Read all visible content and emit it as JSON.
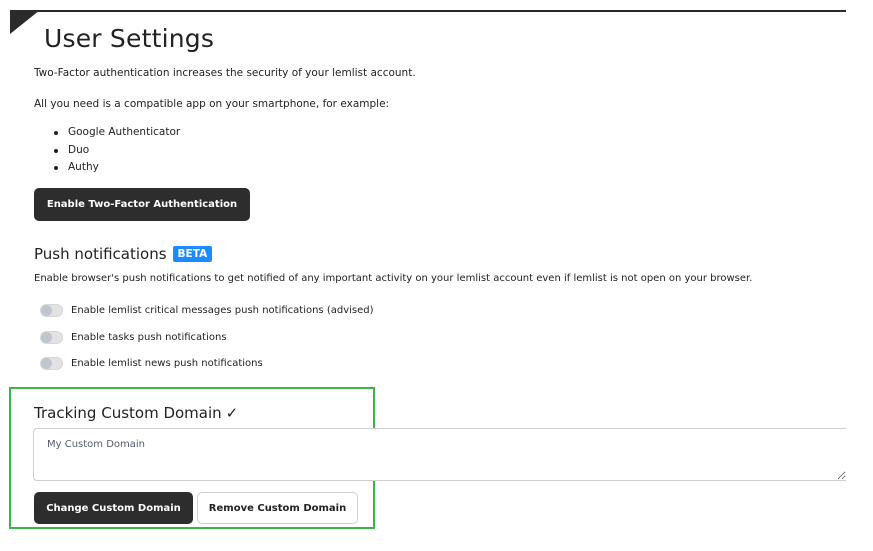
{
  "page": {
    "title": "User Settings"
  },
  "two_factor": {
    "intro": "Two-Factor authentication increases the security of your lemlist account.",
    "apps_lead": "All you need is a compatible app on your smartphone, for example:",
    "apps": [
      "Google Authenticator",
      "Duo",
      "Authy"
    ],
    "enable_button": "Enable Two-Factor Authentication"
  },
  "push_notifications": {
    "heading": "Push notifications",
    "badge": "BETA",
    "badge_color": "#1a8cff",
    "description": "Enable browser's push notifications to get notified of any important activity on your lemlist account even if lemlist is not open on your browser.",
    "toggles": [
      {
        "label": "Enable lemlist critical messages push notifications (advised)",
        "enabled": false
      },
      {
        "label": "Enable tasks push notifications",
        "enabled": false
      },
      {
        "label": "Enable lemlist news push notifications",
        "enabled": false
      }
    ]
  },
  "tracking_domain": {
    "heading": "Tracking Custom Domain",
    "check_icon": "✓",
    "input_placeholder": "My Custom Domain",
    "input_value": "",
    "change_button": "Change Custom Domain",
    "remove_button": "Remove Custom Domain",
    "highlight_color": "#3cb44b"
  }
}
